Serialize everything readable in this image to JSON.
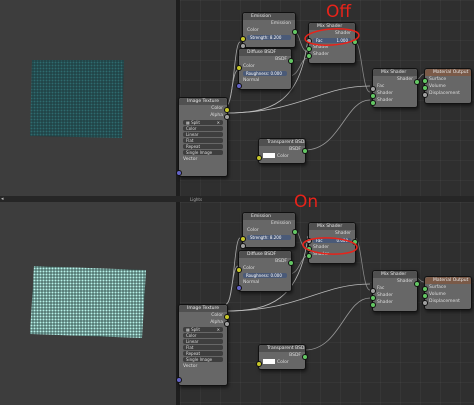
{
  "top": {
    "emission": {
      "title": "Emission",
      "out": "Emission",
      "color": "Color",
      "strength": "Strength: 8.200"
    },
    "diffuse": {
      "title": "Diffuse BSDF",
      "out": "BSDF",
      "color": "Color",
      "roughness": "Roughness: 0.000",
      "normal": "Normal"
    },
    "mix1": {
      "title": "Mix Shader",
      "out": "Shader",
      "fac": "Fac",
      "fac_value": "1.000",
      "shader1": "Shader",
      "shader2": "Shader"
    },
    "mix2": {
      "title": "Mix Shader",
      "out": "Shader",
      "fac": "Fac",
      "shader1": "Shader",
      "shader2": "Shader"
    },
    "output": {
      "title": "Material Output",
      "surface": "Surface",
      "volume": "Volume",
      "displacement": "Displacement"
    },
    "image_texture": {
      "title": "Image Texture",
      "out_color": "Color",
      "out_alpha": "Alpha",
      "image_name": "Split",
      "color_mode": "Color",
      "interpolation": "Linear",
      "projection": "Flat",
      "extension": "Repeat",
      "source": "Single Image",
      "vector": "Vector"
    },
    "transparent": {
      "title": "Transparent BSDF",
      "out": "BSDF",
      "color": "Color"
    }
  },
  "bottom": {
    "emission": {
      "title": "Emission",
      "out": "Emission",
      "color": "Color",
      "strength": "Strength: 8.200"
    },
    "diffuse": {
      "title": "Diffuse BSDF",
      "out": "BSDF",
      "color": "Color",
      "roughness": "Roughness: 0.000",
      "normal": "Normal"
    },
    "mix1": {
      "title": "Mix Shader",
      "out": "Shader",
      "fac": "Fac",
      "fac_value": "0.000",
      "shader1": "Shader",
      "shader2": "Shader"
    },
    "mix2": {
      "title": "Mix Shader",
      "out": "Shader",
      "fac": "Fac",
      "shader1": "Shader",
      "shader2": "Shader"
    },
    "output": {
      "title": "Material Output",
      "surface": "Surface",
      "volume": "Volume",
      "displacement": "Displacement"
    },
    "image_texture": {
      "title": "Image Texture",
      "out_color": "Color",
      "out_alpha": "Alpha",
      "image_name": "Split",
      "color_mode": "Color",
      "interpolation": "Linear",
      "projection": "Flat",
      "extension": "Repeat",
      "source": "Single Image",
      "vector": "Vector"
    },
    "transparent": {
      "title": "Transparent BSDF",
      "out": "BSDF",
      "color": "Color"
    }
  },
  "annotations": {
    "top": "Off",
    "bottom": "On"
  },
  "divider_label": "Lights",
  "colors": {
    "annotation": "#e8231a",
    "mesh_dim": "#2e6b6e",
    "mesh_bright": "#b8f2ea",
    "shader_socket": "#63c763",
    "color_socket": "#c7c729"
  }
}
